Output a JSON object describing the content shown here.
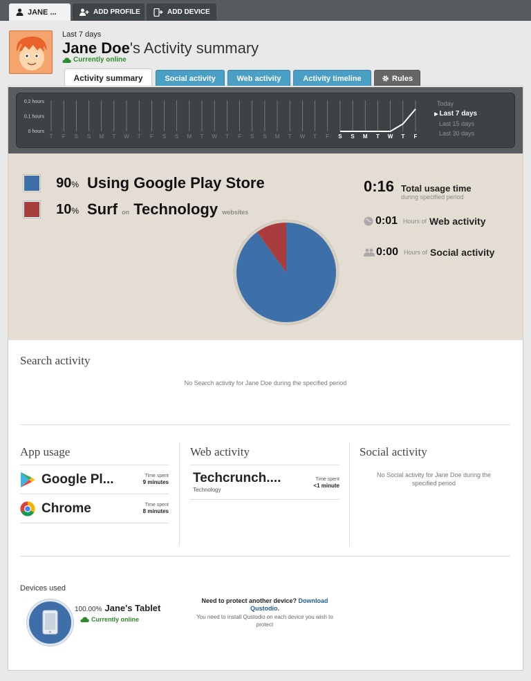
{
  "top_tabs": {
    "profile": "JANE ...",
    "add_profile": "ADD PROFILE",
    "add_device": "ADD DEVICE"
  },
  "header": {
    "period": "Last 7 days",
    "name": "Jane Doe",
    "title_suffix": "'s Activity summary",
    "status": "Currently online"
  },
  "sub_tabs": {
    "summary": "Activity summary",
    "social": "Social activity",
    "web": "Web activity",
    "timeline": "Activity timeline",
    "rules": "Rules"
  },
  "timeline": {
    "yticks": [
      "0.2 hours",
      "0.1 hours",
      "0 hours"
    ],
    "days": [
      "T",
      "F",
      "S",
      "S",
      "M",
      "T",
      "W",
      "T",
      "F",
      "S",
      "S",
      "M",
      "T",
      "W",
      "T",
      "F",
      "S",
      "S",
      "M",
      "T",
      "W",
      "T",
      "F",
      "S",
      "S",
      "M",
      "T",
      "W",
      "T",
      "F"
    ],
    "ranges": [
      "Today",
      "Last 7 days",
      "Last 15 days",
      "Last 30 days"
    ],
    "selected_range": "Last 7 days"
  },
  "chart_data": [
    {
      "type": "line",
      "x": [
        "S",
        "S",
        "M",
        "T",
        "W",
        "T",
        "F"
      ],
      "ylabel": "",
      "ylim": [
        0,
        0.2
      ],
      "series": [
        {
          "values": [
            0,
            0,
            0,
            0,
            0,
            0.05,
            0.15
          ]
        }
      ]
    },
    {
      "type": "pie",
      "categories": [
        "Using Google Play Store",
        "Surf on Technology websites"
      ],
      "values": [
        90,
        10
      ],
      "colors": [
        "#3d6fa9",
        "#a93d3d"
      ]
    }
  ],
  "summary": {
    "items": [
      {
        "pct": "90",
        "unit": "%",
        "name": "Using Google Play Store",
        "color": "#3d6fa9"
      },
      {
        "pct": "10",
        "unit": "%",
        "name_a": "Surf",
        "on": "on",
        "name_b": "Technology",
        "sub": "websites",
        "color": "#a93d3d"
      }
    ],
    "total": {
      "value": "0:16",
      "label": "Total usage time",
      "sub": "during specified period"
    },
    "web": {
      "value": "0:01",
      "hours": "Hours of",
      "label": "Web activity"
    },
    "social": {
      "value": "0:00",
      "hours": "Hours of",
      "label": "Social activity"
    }
  },
  "search": {
    "heading": "Search activity",
    "empty": "No Search activity for Jane Doe during the specified period"
  },
  "app_usage": {
    "heading": "App usage",
    "items": [
      {
        "name": "Google Pl...",
        "spent_label": "Time spent",
        "spent": "9 minutes"
      },
      {
        "name": "Chrome",
        "spent_label": "Time spent",
        "spent": "8 minutes"
      }
    ]
  },
  "web_activity": {
    "heading": "Web activity",
    "items": [
      {
        "name": "Techcrunch....",
        "category": "Technology",
        "spent_label": "Time spent",
        "spent": "<1 minute"
      }
    ]
  },
  "social_activity": {
    "heading": "Social activity",
    "empty": "No Social activity for Jane Doe during the specified period"
  },
  "devices": {
    "heading": "Devices used",
    "pct": "100.00%",
    "name": "Jane's Tablet",
    "status": "Currently online",
    "cta_text": "Need to protect another device?",
    "cta_link": "Download Qustodio.",
    "cta_sub": "You need to install Qustodio on each device you wish to protect"
  },
  "colors": {
    "accent": "#4a9fc5",
    "online": "#2f8a2f",
    "pie_blue": "#3d6fa9",
    "pie_red": "#a93d3d"
  }
}
